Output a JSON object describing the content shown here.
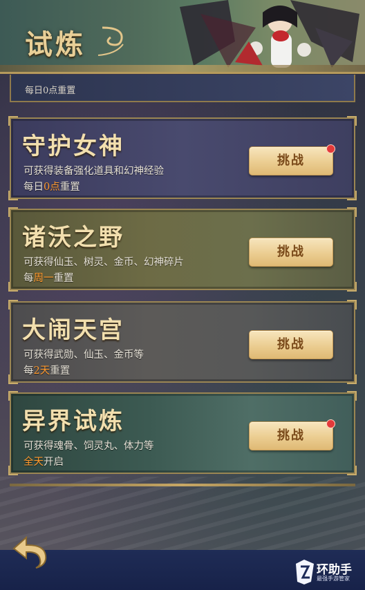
{
  "header": {
    "title": "试炼"
  },
  "partial_card": {
    "reset_text": "每日0点重置"
  },
  "cards": [
    {
      "title": "守护女神",
      "desc": "可获得装备强化道具和幻神经验",
      "reset_prefix": "每日",
      "reset_highlight": "0点",
      "reset_suffix": "重置",
      "button": "挑战",
      "has_dot": true
    },
    {
      "title": "诸沃之野",
      "desc": "可获得仙玉、树灵、金币、幻神碎片",
      "reset_prefix": "每",
      "reset_highlight": "周一",
      "reset_suffix": "重置",
      "button": "挑战",
      "has_dot": false
    },
    {
      "title": "大闹天宫",
      "desc": "可获得武勋、仙玉、金币等",
      "reset_prefix": "每",
      "reset_highlight": "2天",
      "reset_suffix": "重置",
      "button": "挑战",
      "has_dot": false
    },
    {
      "title": "异界试炼",
      "desc": "可获得魂骨、饲灵丸、体力等",
      "reset_prefix": "",
      "reset_highlight": "全天",
      "reset_suffix": "开启",
      "button": "挑战",
      "has_dot": true
    }
  ],
  "watermark": {
    "main": "环助手",
    "sub": "最强手游管家"
  },
  "colors": {
    "gold": "#e8cf97",
    "highlight": "#ff9a2e",
    "badge": "#e33a3a"
  }
}
